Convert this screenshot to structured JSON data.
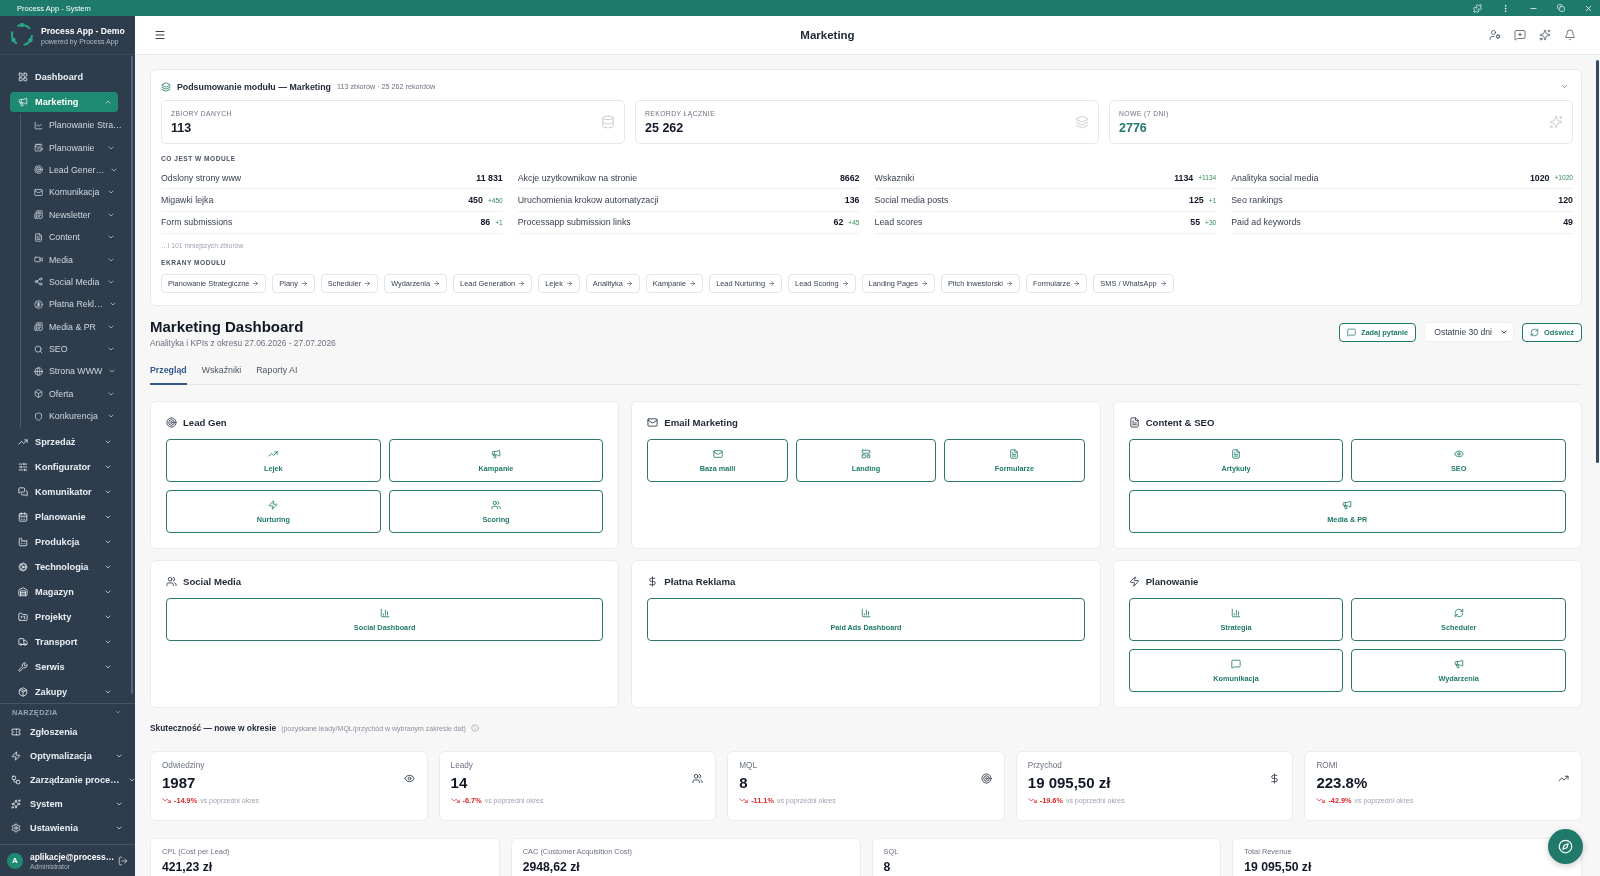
{
  "titlebar": {
    "title": "Process App - System"
  },
  "sidebar": {
    "brand": {
      "name": "Process App - Demo",
      "tagline": "powered by Process App"
    },
    "items": [
      {
        "label": "Dashboard",
        "kind": "link",
        "selected": false
      },
      {
        "label": "Marketing",
        "kind": "group",
        "selected": true,
        "expanded": true,
        "children": [
          {
            "label": "Planowanie Stra…",
            "kind": "link",
            "selected": false
          },
          {
            "label": "Planowanie",
            "kind": "group",
            "selected": false,
            "expanded": false
          },
          {
            "label": "Lead Gener…",
            "kind": "group",
            "selected": false,
            "expanded": false
          },
          {
            "label": "Komunikacja",
            "kind": "group",
            "selected": false,
            "expanded": false
          },
          {
            "label": "Newsletter",
            "kind": "group",
            "selected": false,
            "expanded": false
          },
          {
            "label": "Content",
            "kind": "group",
            "selected": false,
            "expanded": false
          },
          {
            "label": "Media",
            "kind": "group",
            "selected": false,
            "expanded": false
          },
          {
            "label": "Social Media",
            "kind": "group",
            "selected": false,
            "expanded": false
          },
          {
            "label": "Płatna Rekl…",
            "kind": "group",
            "selected": false,
            "expanded": false
          },
          {
            "label": "Media & PR",
            "kind": "group",
            "selected": false,
            "expanded": false
          },
          {
            "label": "SEO",
            "kind": "group",
            "selected": false,
            "expanded": false
          },
          {
            "label": "Strona WWW",
            "kind": "group",
            "selected": false,
            "expanded": false
          },
          {
            "label": "Oferta",
            "kind": "group",
            "selected": false,
            "expanded": false
          },
          {
            "label": "Konkurencja",
            "kind": "group",
            "selected": false,
            "expanded": false
          }
        ]
      },
      {
        "label": "Sprzedaż",
        "kind": "group",
        "selected": false,
        "expanded": false
      },
      {
        "label": "Konfigurator",
        "kind": "group",
        "selected": false,
        "expanded": false
      },
      {
        "label": "Komunikator",
        "kind": "group",
        "selected": false,
        "expanded": false
      },
      {
        "label": "Planowanie",
        "kind": "group",
        "selected": false,
        "expanded": false
      },
      {
        "label": "Produkcja",
        "kind": "group",
        "selected": false,
        "expanded": false
      },
      {
        "label": "Technologia",
        "kind": "group",
        "selected": false,
        "expanded": false
      },
      {
        "label": "Magazyn",
        "kind": "group",
        "selected": false,
        "expanded": false
      },
      {
        "label": "Projekty",
        "kind": "group",
        "selected": false,
        "expanded": false
      },
      {
        "label": "Transport",
        "kind": "group",
        "selected": false,
        "expanded": false
      },
      {
        "label": "Serwis",
        "kind": "group",
        "selected": false,
        "expanded": false
      },
      {
        "label": "Zakupy",
        "kind": "group",
        "selected": false,
        "expanded": false
      }
    ],
    "tools": {
      "label": "NARZĘDZIA",
      "items": [
        {
          "label": "Zgłoszenia",
          "kind": "link",
          "selected": false
        },
        {
          "label": "Optymalizacja",
          "kind": "group",
          "selected": false,
          "expanded": false
        },
        {
          "label": "Zarządzanie proce…",
          "kind": "group",
          "selected": false,
          "expanded": false
        },
        {
          "label": "System",
          "kind": "group",
          "selected": false,
          "expanded": false
        },
        {
          "label": "Ustawienia",
          "kind": "group",
          "selected": false,
          "expanded": false
        }
      ]
    },
    "user": {
      "initial": "A",
      "email": "aplikacje@process…",
      "role": "Administrator"
    }
  },
  "header": {
    "title": "Marketing"
  },
  "summary": {
    "title": "Podsumowanie modułu — Marketing",
    "meta": "113 zbiorów · 25 262 rekordów",
    "expanded": true,
    "stats": [
      {
        "label": "ZBIORY DANYCH",
        "value": "113",
        "kind": "count"
      },
      {
        "label": "REKORDY ŁĄCZNIE",
        "value": "25 262",
        "kind": "count"
      },
      {
        "label": "NOWE (7 DNI)",
        "value": "2776",
        "kind": "new"
      }
    ],
    "contents_label": "CO JEST W MODULE",
    "contents": [
      {
        "label": "Odslony strony www",
        "value": "11 831"
      },
      {
        "label": "Akcje uzytkownikow na stronie",
        "value": "8662"
      },
      {
        "label": "Wskazniki",
        "value": "1134",
        "delta": "+1134"
      },
      {
        "label": "Analityka social media",
        "value": "1020",
        "delta": "+1020"
      },
      {
        "label": "Migawki lejka",
        "value": "450",
        "delta": "+450"
      },
      {
        "label": "Uruchomienia krokow automatyzacji",
        "value": "136"
      },
      {
        "label": "Social media posts",
        "value": "125",
        "delta": "+1"
      },
      {
        "label": "Seo rankings",
        "value": "120"
      },
      {
        "label": "Form submissions",
        "value": "86",
        "delta": "+1"
      },
      {
        "label": "Processapp submission links",
        "value": "62",
        "delta": "+45"
      },
      {
        "label": "Lead scores",
        "value": "55",
        "delta": "+30"
      },
      {
        "label": "Paid ad keywords",
        "value": "49"
      }
    ],
    "more": "…i 101 mniejszych zbiorów",
    "screens_label": "EKRANY MODUŁU",
    "screens": [
      "Planowanie Strategiczne",
      "Plany",
      "Scheduler",
      "Wydarzenia",
      "Lead Generation",
      "Lejek",
      "Analityka",
      "Kampanie",
      "Lead Nurturing",
      "Lead Scoring",
      "Landing Pages",
      "Pitch inwestorski",
      "Formularze",
      "SMS / WhatsApp"
    ]
  },
  "dashboard": {
    "title": "Marketing Dashboard",
    "subtitle": "Analityka i KPIs z okresu 27.06.2026 - 27.07.2026",
    "ask_button": "Zadaj pytanie",
    "period_select": {
      "value": "Ostatnie 30 dni"
    },
    "refresh_button": "Odśwież",
    "tabs": [
      {
        "label": "Przegląd",
        "selected": true
      },
      {
        "label": "Wskaźniki",
        "selected": false
      },
      {
        "label": "Raporty AI",
        "selected": false
      }
    ],
    "sections": [
      {
        "title": "Lead Gen",
        "tiles": [
          {
            "label": "Lejek",
            "kind": "tile"
          },
          {
            "label": "Kampanie",
            "kind": "tile"
          },
          {
            "label": "Nurturing",
            "kind": "tile"
          },
          {
            "label": "Scoring",
            "kind": "tile"
          }
        ]
      },
      {
        "title": "Email Marketing",
        "tiles": [
          {
            "label": "Baza maili",
            "kind": "tile"
          },
          {
            "label": "Landing",
            "kind": "tile"
          },
          {
            "label": "Formularze",
            "kind": "tile"
          }
        ]
      },
      {
        "title": "Content & SEO",
        "tiles": [
          {
            "label": "Artykuły",
            "kind": "tile"
          },
          {
            "label": "SEO",
            "kind": "tile"
          },
          {
            "label": "Media & PR",
            "kind": "wide"
          }
        ]
      },
      {
        "title": "Social Media",
        "tiles": [
          {
            "label": "Social Dashboard",
            "kind": "tile"
          }
        ]
      },
      {
        "title": "Płatna Reklama",
        "tiles": [
          {
            "label": "Paid Ads Dashboard",
            "kind": "tile"
          }
        ]
      },
      {
        "title": "Planowanie",
        "tiles": [
          {
            "label": "Strategia",
            "kind": "tile"
          },
          {
            "label": "Scheduler",
            "kind": "tile"
          },
          {
            "label": "Komunikacja",
            "kind": "tile"
          },
          {
            "label": "Wydarzenia",
            "kind": "tile"
          }
        ]
      }
    ],
    "performance": {
      "title": "Skuteczność — nowe w okresie",
      "note": "(pozyskane leady/MQL/przychód w wybranym zakresie dat)",
      "kpis": [
        {
          "label": "Odwiedziny",
          "value": "1987",
          "delta": "-14.9%",
          "decreased": true,
          "comparison": "vs poprzedni okres"
        },
        {
          "label": "Leady",
          "value": "14",
          "delta": "-6.7%",
          "decreased": true,
          "comparison": "vs poprzedni okres"
        },
        {
          "label": "MQL",
          "value": "8",
          "delta": "-11.1%",
          "decreased": true,
          "comparison": "vs poprzedni okres"
        },
        {
          "label": "Przychod",
          "value": "19 095,50 zł",
          "delta": "-19.6%",
          "decreased": true,
          "comparison": "vs poprzedni okres"
        },
        {
          "label": "ROMI",
          "value": "223.8%",
          "delta": "-42.9%",
          "decreased": true,
          "comparison": "vs poprzedni okres"
        }
      ],
      "secondary_kpis": [
        {
          "label": "CPL (Cost per Lead)",
          "value": "421,23 zł"
        },
        {
          "label": "CAC (Customer Acquisition Cost)",
          "value": "2948,62 zł"
        },
        {
          "label": "SQL",
          "value": "8"
        },
        {
          "label": "Total Revenue",
          "value": "19 095,50 zł"
        }
      ]
    }
  }
}
